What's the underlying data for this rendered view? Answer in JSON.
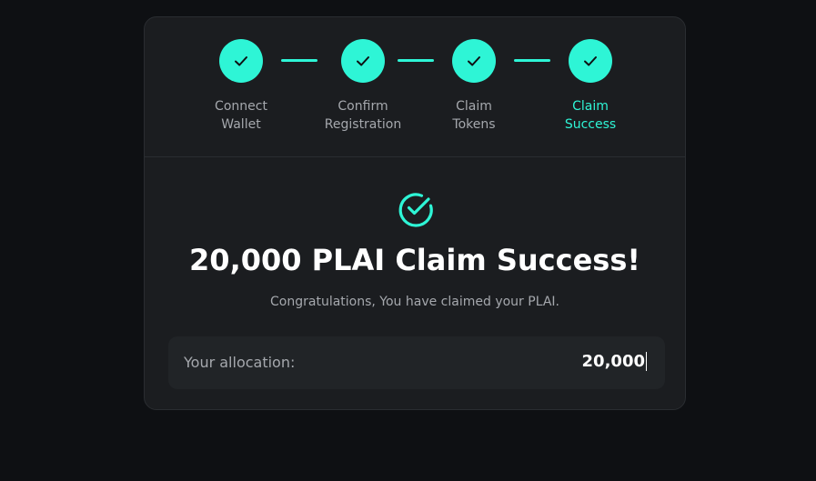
{
  "stepper": {
    "steps": [
      {
        "label": "Connect\nWallet",
        "icon": "check-icon",
        "state": "complete"
      },
      {
        "label": "Confirm\nRegistration",
        "icon": "check-icon",
        "state": "complete"
      },
      {
        "label": "Claim\nTokens",
        "icon": "check-icon",
        "state": "complete"
      },
      {
        "label": "Claim\nSuccess",
        "icon": "check-icon",
        "state": "current"
      }
    ]
  },
  "result": {
    "icon": "check-circle-icon",
    "title": "20,000 PLAI Claim Success!",
    "subtitle": "Congratulations, You have claimed your PLAI."
  },
  "allocation": {
    "label": "Your allocation:",
    "value": "20,000"
  },
  "colors": {
    "accent": "#2ef5d6",
    "background": "#0e1013",
    "card": "#1b1d20",
    "muted_text": "#a5a8ad"
  }
}
